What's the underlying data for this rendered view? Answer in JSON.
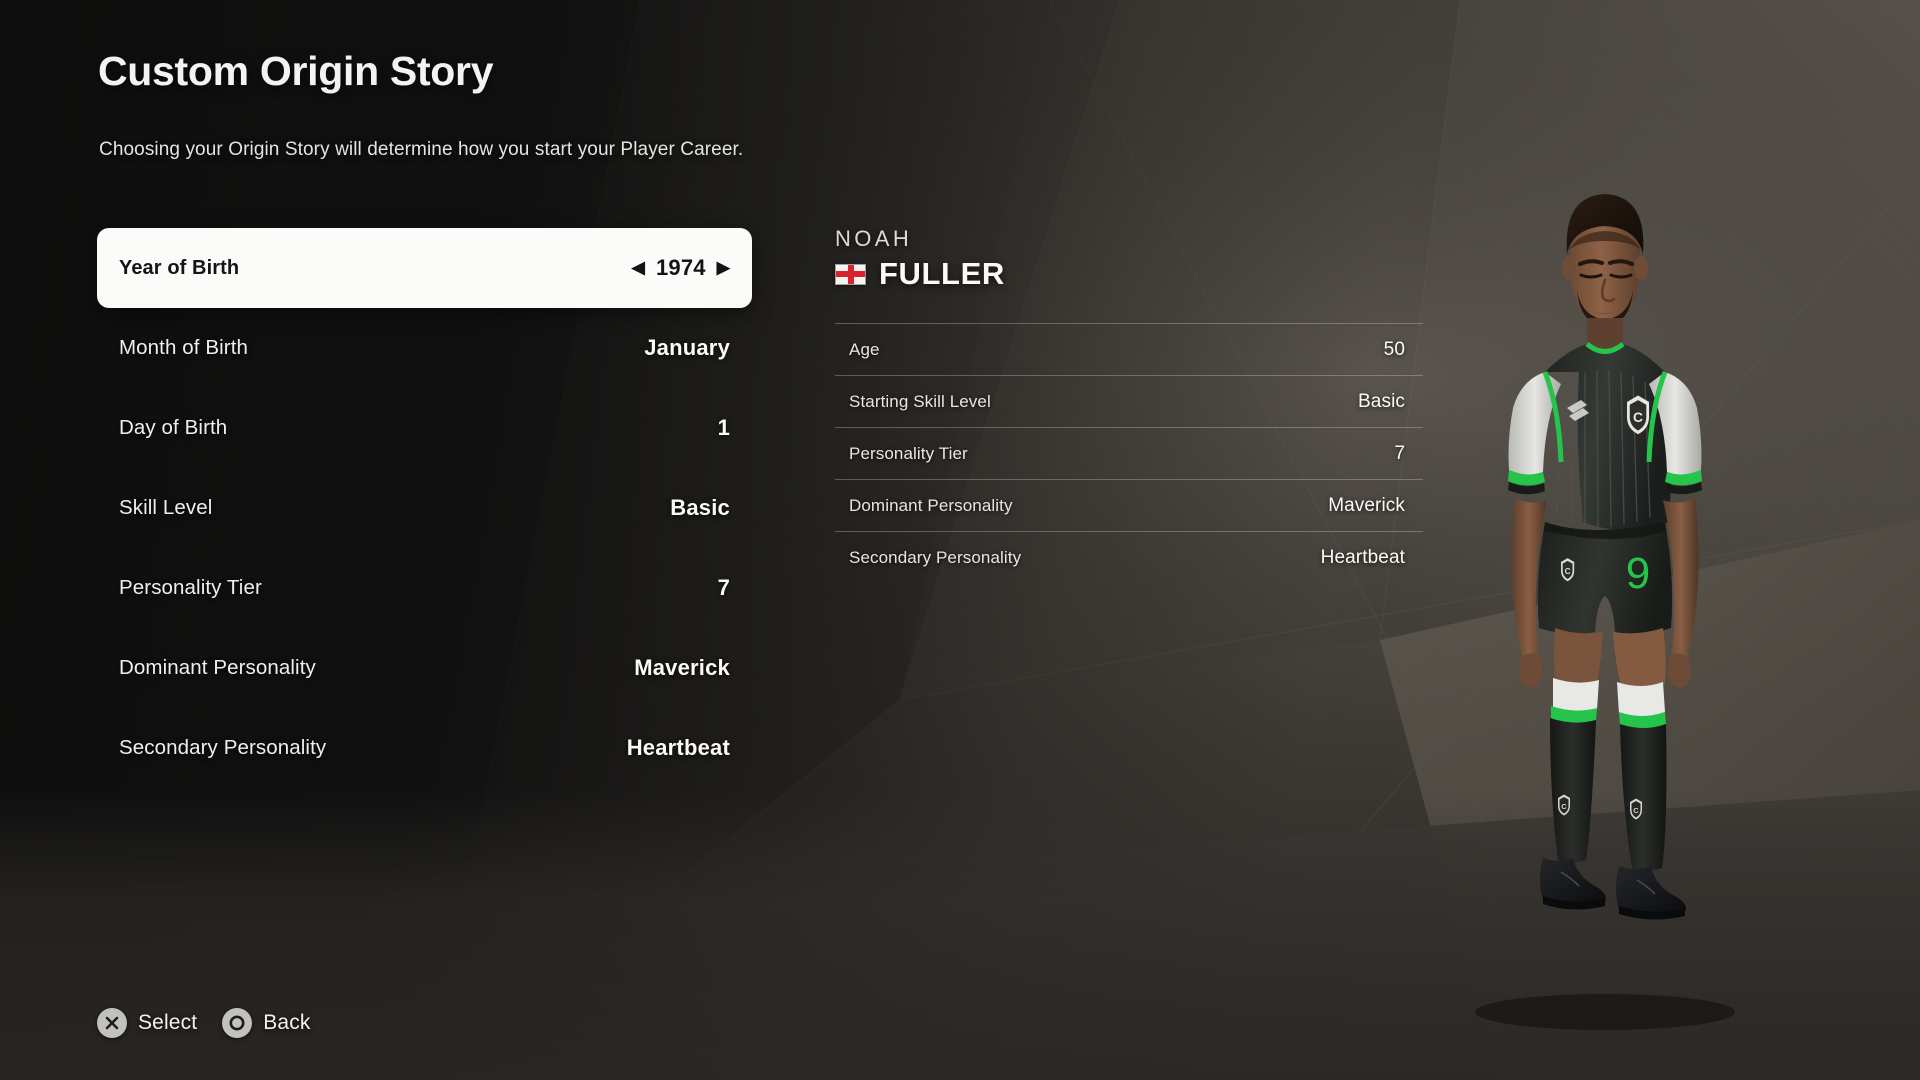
{
  "header": {
    "title": "Custom Origin Story",
    "subtitle": "Choosing your Origin Story will determine how you start your Player Career."
  },
  "options": [
    {
      "label": "Year of Birth",
      "value": "1974",
      "selected": true,
      "left_arrow": "◀",
      "right_arrow": "▶"
    },
    {
      "label": "Month of Birth",
      "value": "January",
      "selected": false
    },
    {
      "label": "Day of Birth",
      "value": "1",
      "selected": false
    },
    {
      "label": "Skill Level",
      "value": "Basic",
      "selected": false
    },
    {
      "label": "Personality Tier",
      "value": "7",
      "selected": false
    },
    {
      "label": "Dominant Personality",
      "value": "Maverick",
      "selected": false
    },
    {
      "label": "Secondary Personality",
      "value": "Heartbeat",
      "selected": false
    }
  ],
  "summary": {
    "first_name": "NOAH",
    "last_name": "FULLER",
    "nationality_flag": "england-flag",
    "stats": [
      {
        "label": "Age",
        "value": "50"
      },
      {
        "label": "Starting Skill Level",
        "value": "Basic"
      },
      {
        "label": "Personality Tier",
        "value": "7"
      },
      {
        "label": "Dominant Personality",
        "value": "Maverick"
      },
      {
        "label": "Secondary Personality",
        "value": "Heartbeat"
      }
    ]
  },
  "actions": [
    {
      "glyph": "cross-button-icon",
      "label": "Select"
    },
    {
      "glyph": "circle-button-icon",
      "label": "Back"
    }
  ],
  "player_model": {
    "shirt_number": "9",
    "kit_primary_color": "#30332f",
    "kit_sleeve_color": "#e8e8e6",
    "kit_accent_color": "#25c44a",
    "boots_color": "#141414"
  },
  "theme": {
    "background_dark": "#141413",
    "background_mid": "#4a4743",
    "selected_row_bg": "#fbfbfa",
    "text_primary": "#fbfaf8",
    "flag_red": "#d8232c"
  }
}
